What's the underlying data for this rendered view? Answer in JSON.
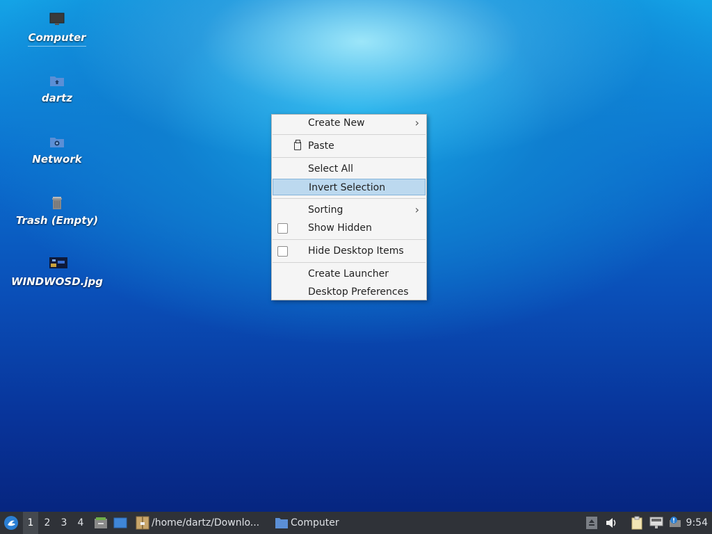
{
  "desktop": {
    "icons": [
      {
        "label": "Computer",
        "icon": "monitor-icon"
      },
      {
        "label": "dartz",
        "icon": "home-folder-icon"
      },
      {
        "label": "Network",
        "icon": "network-folder-icon"
      },
      {
        "label": "Trash (Empty)",
        "icon": "trash-icon"
      },
      {
        "label": "WINDWOSD.jpg",
        "icon": "image-file-icon"
      }
    ]
  },
  "context_menu": {
    "create_new": "Create New",
    "paste": "Paste",
    "select_all": "Select All",
    "invert_selection": "Invert Selection",
    "sorting": "Sorting",
    "show_hidden": "Show Hidden",
    "hide_desktop_items": "Hide Desktop Items",
    "create_launcher": "Create Launcher",
    "desktop_preferences": "Desktop Preferences",
    "submenu_arrow": "›"
  },
  "taskbar": {
    "workspaces": [
      "1",
      "2",
      "3",
      "4"
    ],
    "active_workspace": "1",
    "tasks": [
      {
        "label": "/home/dartz/Downlo...",
        "icon": "archive-icon"
      },
      {
        "label": "Computer",
        "icon": "folder-icon"
      }
    ],
    "clock": "9:54"
  },
  "colors": {
    "menu_highlight": "#bcd9ef",
    "taskbar_bg": "#2f3238"
  }
}
